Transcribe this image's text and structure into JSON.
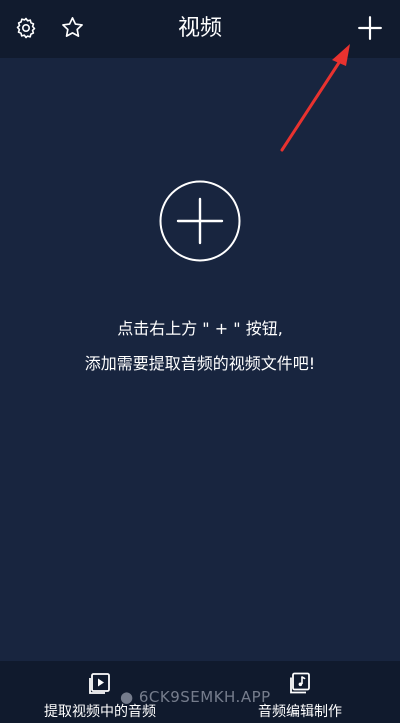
{
  "header": {
    "title": "视频",
    "settings_icon": "gear-icon",
    "favorite_icon": "star-icon",
    "add_icon": "plus-icon"
  },
  "main": {
    "add_icon": "circle-plus-icon",
    "hint_line1": "点击右上方 \" + \" 按钮,",
    "hint_line2": "添加需要提取音频的视频文件吧!"
  },
  "tabbar": {
    "tabs": [
      {
        "label": "提取视频中的音频",
        "icon": "video-play-icon"
      },
      {
        "label": "音频编辑制作",
        "icon": "music-note-icon"
      }
    ]
  },
  "watermark": "● 6CK9SEMKH.APP",
  "colors": {
    "header_bg": "#111b2e",
    "main_bg": "#18253f",
    "tabbar_bg": "#101a2d",
    "arrow": "#e8322f"
  }
}
